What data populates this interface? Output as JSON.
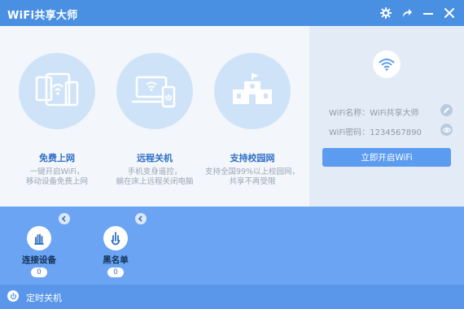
{
  "app": {
    "title": "WiFi共享大师"
  },
  "features": [
    {
      "label": "免费上网",
      "desc1": "一键开启WiFi，",
      "desc2": "移动设备免费上网"
    },
    {
      "label": "远程关机",
      "desc1": "手机变身遥控，",
      "desc2": "躺在床上远程关闭电脑"
    },
    {
      "label": "支持校园网",
      "desc1": "支持全国99%以上校园网，",
      "desc2": "共享不再受限"
    }
  ],
  "settings": {
    "name_label": "WiFi名称：",
    "name_value": "WiFi共享大师",
    "password_label": "WiFi密码：",
    "password_value": "1234567890",
    "start_button": "立即开启WiFi"
  },
  "bottom": {
    "items": [
      {
        "label": "连接设备",
        "count": "0"
      },
      {
        "label": "黑名单",
        "count": "0"
      }
    ]
  },
  "footer": {
    "label": "定时关机"
  },
  "colors": {
    "accent": "#4a90e2",
    "panel": "#6aa4f2",
    "circle": "#cfe3f8"
  }
}
